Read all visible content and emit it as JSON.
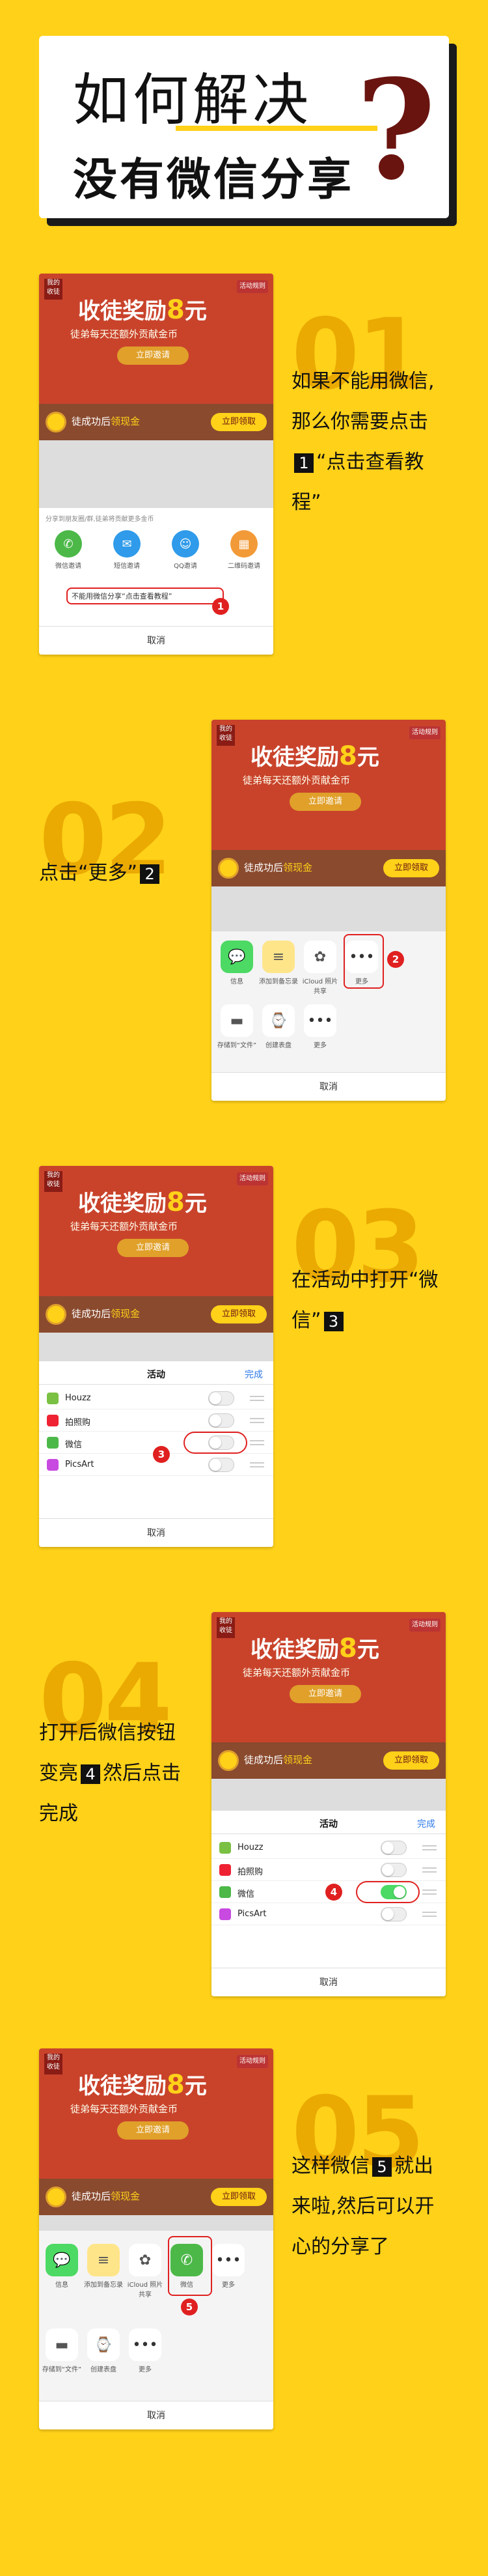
{
  "title": {
    "line1": "如何解决",
    "line2": "没有微信分享",
    "mark": "?"
  },
  "app": {
    "tag": "我的收徒",
    "rule": "活动规则",
    "header_pre": "收徒奖励",
    "header_num": "8",
    "header_post": "元",
    "sub": "徒弟每天还额外贡献金币",
    "invite_btn": "立即邀请",
    "band_text": "徒成功后",
    "band_highlight": "领现金",
    "band_btn": "立即领取"
  },
  "steps": [
    {
      "num": "01",
      "text": [
        "如果不能用微信,",
        "那么你需要点击",
        "“点击查看教",
        "程”"
      ],
      "badge": "1"
    },
    {
      "num": "02",
      "text_pre": "点击“更多”",
      "badge": "2"
    },
    {
      "num": "03",
      "text": [
        "在活动中打开“微",
        "信”"
      ],
      "badge": "3"
    },
    {
      "num": "04",
      "text": [
        "打开后微信按钮",
        "变亮",
        "然后点击",
        "完成"
      ],
      "badge": "4"
    },
    {
      "num": "05",
      "text": [
        "这样微信",
        "就出",
        "来啦,然后可以开",
        "心的分享了"
      ],
      "badge": "5"
    }
  ],
  "share1": {
    "items": [
      "微信邀请",
      "短信邀请",
      "QQ邀请",
      "二维码邀请"
    ],
    "link": "不能用微信分享“点击查看教程”",
    "cancel": "取消",
    "hint": "分享到朋友圈/群,徒弟将贡献更多金币"
  },
  "share2": {
    "top": [
      "信息",
      "添加到备忘录",
      "iCloud 照片共享",
      "更多"
    ],
    "bottom": [
      "存储到“文件”",
      "创建表盘",
      "更多"
    ],
    "cancel": "取消"
  },
  "activity": {
    "title": "活动",
    "done": "完成",
    "rows": [
      "Houzz",
      "拍照购",
      "微信",
      "PicsArt"
    ],
    "cancel": "取消"
  },
  "share5": {
    "top": [
      "信息",
      "添加到备忘录",
      "iCloud 照片共享",
      "微信",
      "更多"
    ],
    "bottom": [
      "存储到“文件”",
      "创建表盘",
      "更多"
    ],
    "cancel": "取消"
  },
  "colors": {
    "bg": "#FFD119",
    "accent": "#E02020",
    "dark": "#111111"
  }
}
